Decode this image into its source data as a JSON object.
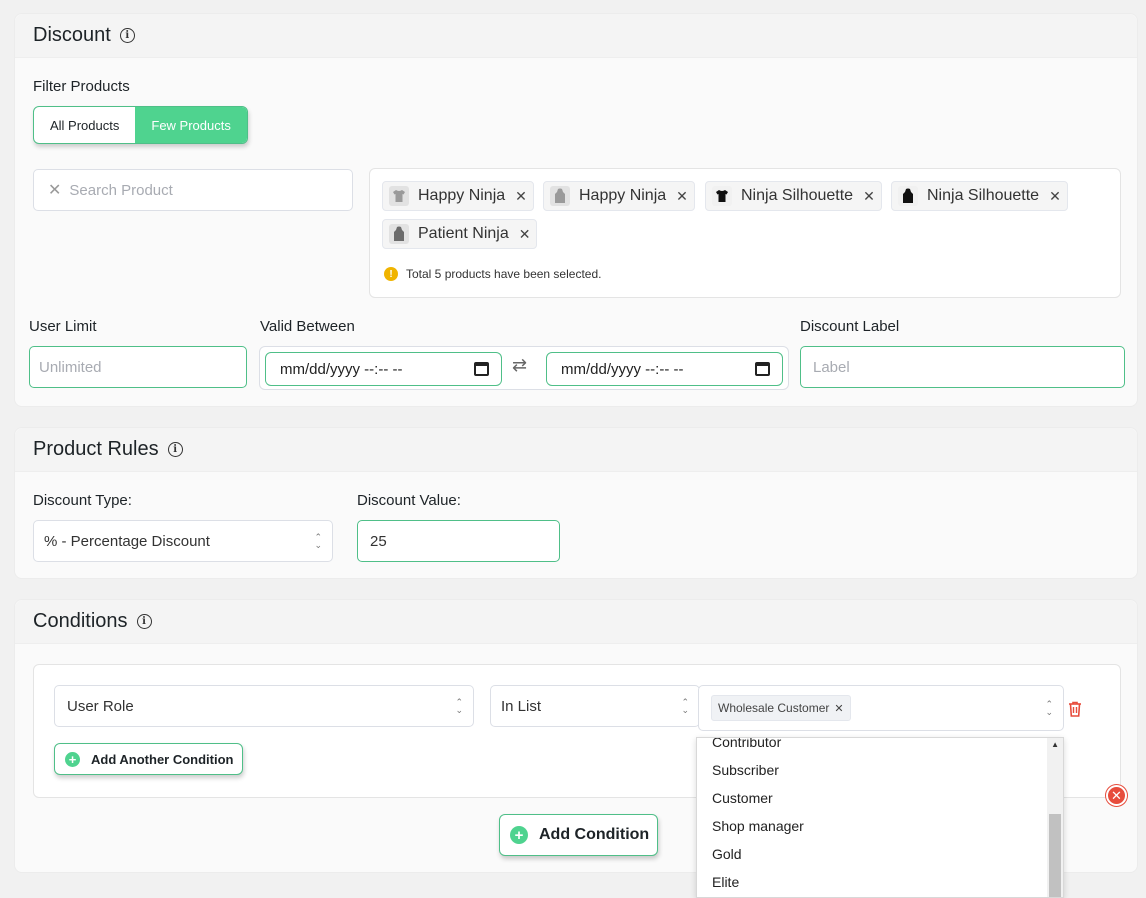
{
  "discount": {
    "title": "Discount",
    "filter_label": "Filter Products",
    "filter_options": [
      "All Products",
      "Few Products"
    ],
    "filter_selected": "Few Products",
    "search_placeholder": "Search Product",
    "products": [
      {
        "name": "Happy Ninja",
        "thumb": "tshirt-icon"
      },
      {
        "name": "Happy Ninja",
        "thumb": "hoodie-icon"
      },
      {
        "name": "Ninja Silhouette",
        "thumb": "tshirt-icon"
      },
      {
        "name": "Ninja Silhouette",
        "thumb": "hoodie-icon"
      },
      {
        "name": "Patient Ninja",
        "thumb": "hoodie-icon"
      }
    ],
    "notice": "Total 5 products have been selected.",
    "user_limit_label": "User Limit",
    "user_limit_placeholder": "Unlimited",
    "valid_between_label": "Valid Between",
    "date_start": "mm/dd/yyyy --:-- --",
    "date_end": "mm/dd/yyyy --:-- --",
    "discount_label_label": "Discount Label",
    "discount_label_placeholder": "Label"
  },
  "product_rules": {
    "title": "Product Rules",
    "discount_type_label": "Discount Type:",
    "discount_type_value": "% - Percentage Discount",
    "discount_value_label": "Discount Value:",
    "discount_value": "25"
  },
  "conditions": {
    "title": "Conditions",
    "condition_field": "User Role",
    "condition_operator": "In List",
    "selected_roles": [
      "Wholesale Customer"
    ],
    "add_another_label": "Add Another Condition",
    "add_condition_label": "Add Condition",
    "dropdown_options": [
      "Contributor",
      "Subscriber",
      "Customer",
      "Shop manager",
      "Gold",
      "Elite"
    ]
  },
  "colors": {
    "accent": "#4fd38f",
    "accent_border": "#4fbf88",
    "danger": "#e74c3c",
    "warning": "#f0b400"
  }
}
